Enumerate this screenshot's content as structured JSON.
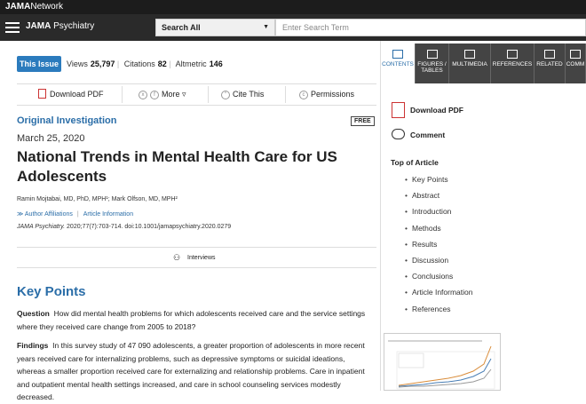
{
  "network": {
    "brand": "JAMA",
    "suffix": "Network"
  },
  "header": {
    "journal_bold": "JAMA",
    "journal_name": "Psychiatry"
  },
  "search": {
    "scope": "Search All",
    "placeholder": "Enter Search Term"
  },
  "issue": {
    "pill": "This Issue",
    "views_label": "Views",
    "views": "25,797",
    "citations_label": "Citations",
    "citations": "82",
    "altmetric_label": "Altmetric",
    "altmetric": "146"
  },
  "toolbar": {
    "download_pdf": "Download PDF",
    "more": "More",
    "cite_this": "Cite This",
    "permissions": "Permissions"
  },
  "article": {
    "type": "Original Investigation",
    "free_badge": "FREE",
    "date": "March 25, 2020",
    "title": "National Trends in Mental Health Care for US Adolescents",
    "authors": "Ramin Mojtabai, MD, PhD, MPH¹; Mark Olfson, MD, MPH²",
    "author_affiliations": "Author Affiliations",
    "article_information": "Article Information",
    "citation_journal": "JAMA Psychiatry.",
    "citation_rest": "2020;77(7):703-714. doi:10.1001/jamapsychiatry.2020.0279",
    "interviews": "Interviews"
  },
  "key_points": {
    "heading": "Key Points",
    "question_label": "Question",
    "question_text": "How did mental health problems for which adolescents received care and the service settings where they received care change from 2005 to 2018?",
    "findings_label": "Findings",
    "findings_text": "In this survey study of 47 090 adolescents, a greater proportion of adolescents in more recent years received care for internalizing problems, such as depressive symptoms or suicidal ideations, whereas a smaller proportion received care for externalizing and relationship problems. Care in inpatient and outpatient mental health settings increased, and care in school counseling services modestly decreased."
  },
  "right_tabs": [
    {
      "label": "CONTENTS"
    },
    {
      "label": "FIGURES / TABLES"
    },
    {
      "label": "MULTIMEDIA"
    },
    {
      "label": "REFERENCES"
    },
    {
      "label": "RELATED"
    },
    {
      "label": "COMM"
    }
  ],
  "right_actions": {
    "download_pdf": "Download PDF",
    "comment": "Comment"
  },
  "toc": {
    "heading": "Top of Article",
    "items": [
      "Key Points",
      "Abstract",
      "Introduction",
      "Methods",
      "Results",
      "Discussion",
      "Conclusions",
      "Article Information",
      "References"
    ]
  }
}
